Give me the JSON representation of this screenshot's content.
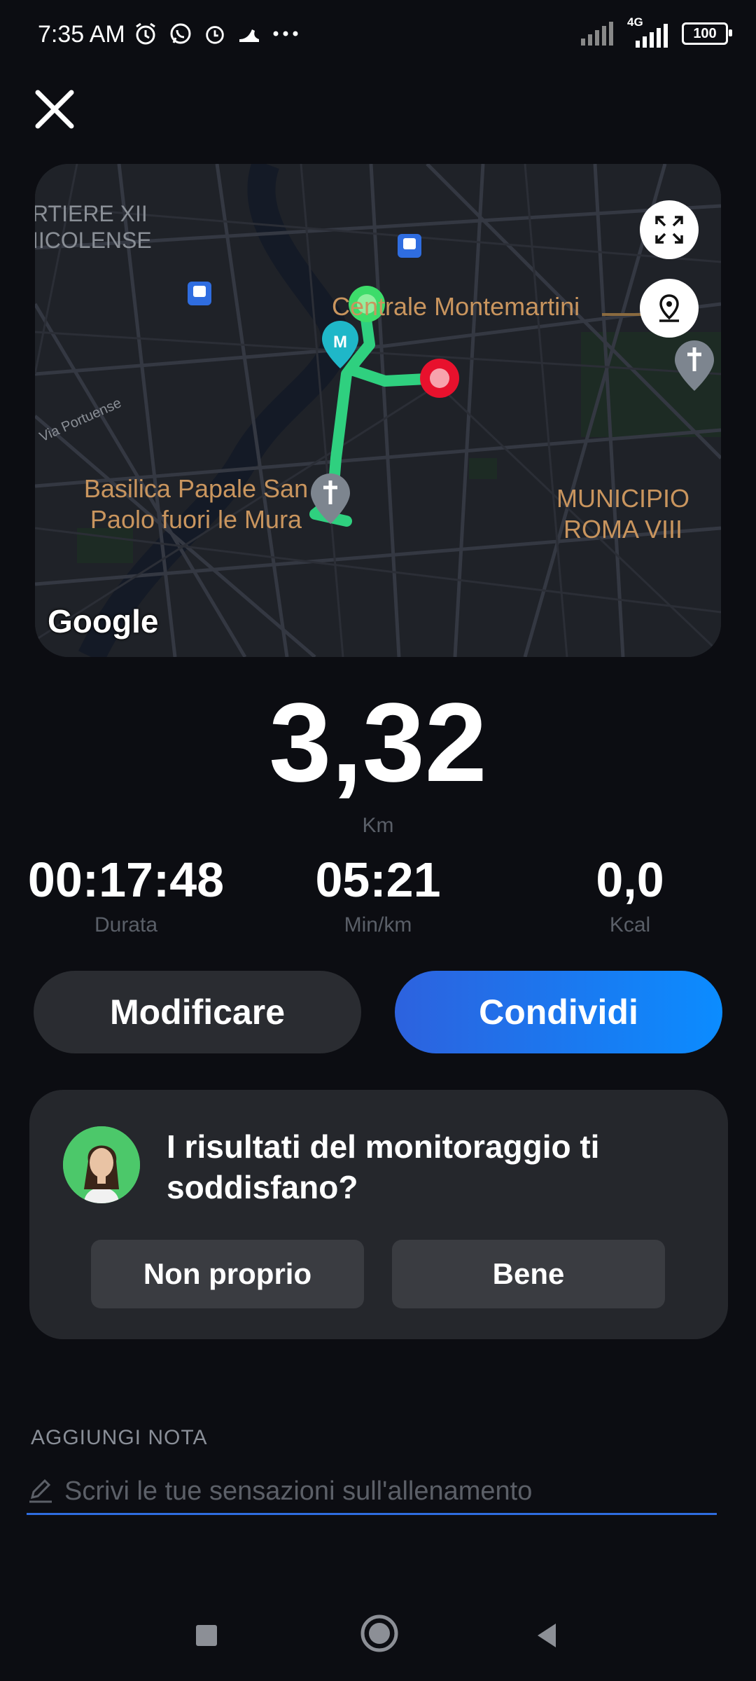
{
  "status_bar": {
    "time": "7:35 AM",
    "network": "4G",
    "battery": "100"
  },
  "map": {
    "labels": {
      "district_top_left_1": "RTIERE XII",
      "district_top_left_2": "IICOLENSE",
      "centrale": "Centrale Montemartini",
      "via": "Via Portuense",
      "basilica_1": "Basilica Papale San",
      "basilica_2": "Paolo fuori le Mura",
      "municipio_1": "MUNICIPIO",
      "municipio_2": "ROMA VIII"
    },
    "brand": "Google",
    "route_color": "#2fd07f",
    "start_color": "#3ddc6a",
    "end_color": "#e8112d"
  },
  "stats": {
    "distance_value": "3,32",
    "distance_unit": "Km",
    "duration_value": "00:17:48",
    "duration_label": "Durata",
    "pace_value": "05:21",
    "pace_label": "Min/km",
    "kcal_value": "0,0",
    "kcal_label": "Kcal"
  },
  "actions": {
    "edit_label": "Modificare",
    "share_label": "Condividi"
  },
  "feedback": {
    "question": "I risultati del monitoraggio ti soddisfano?",
    "option_no": "Non proprio",
    "option_yes": "Bene"
  },
  "note": {
    "title": "AGGIUNGI NOTA",
    "placeholder": "Scrivi le tue sensazioni sull'allenamento",
    "value": ""
  },
  "colors": {
    "background": "#0c0d12",
    "accent": "#0b8cff"
  }
}
